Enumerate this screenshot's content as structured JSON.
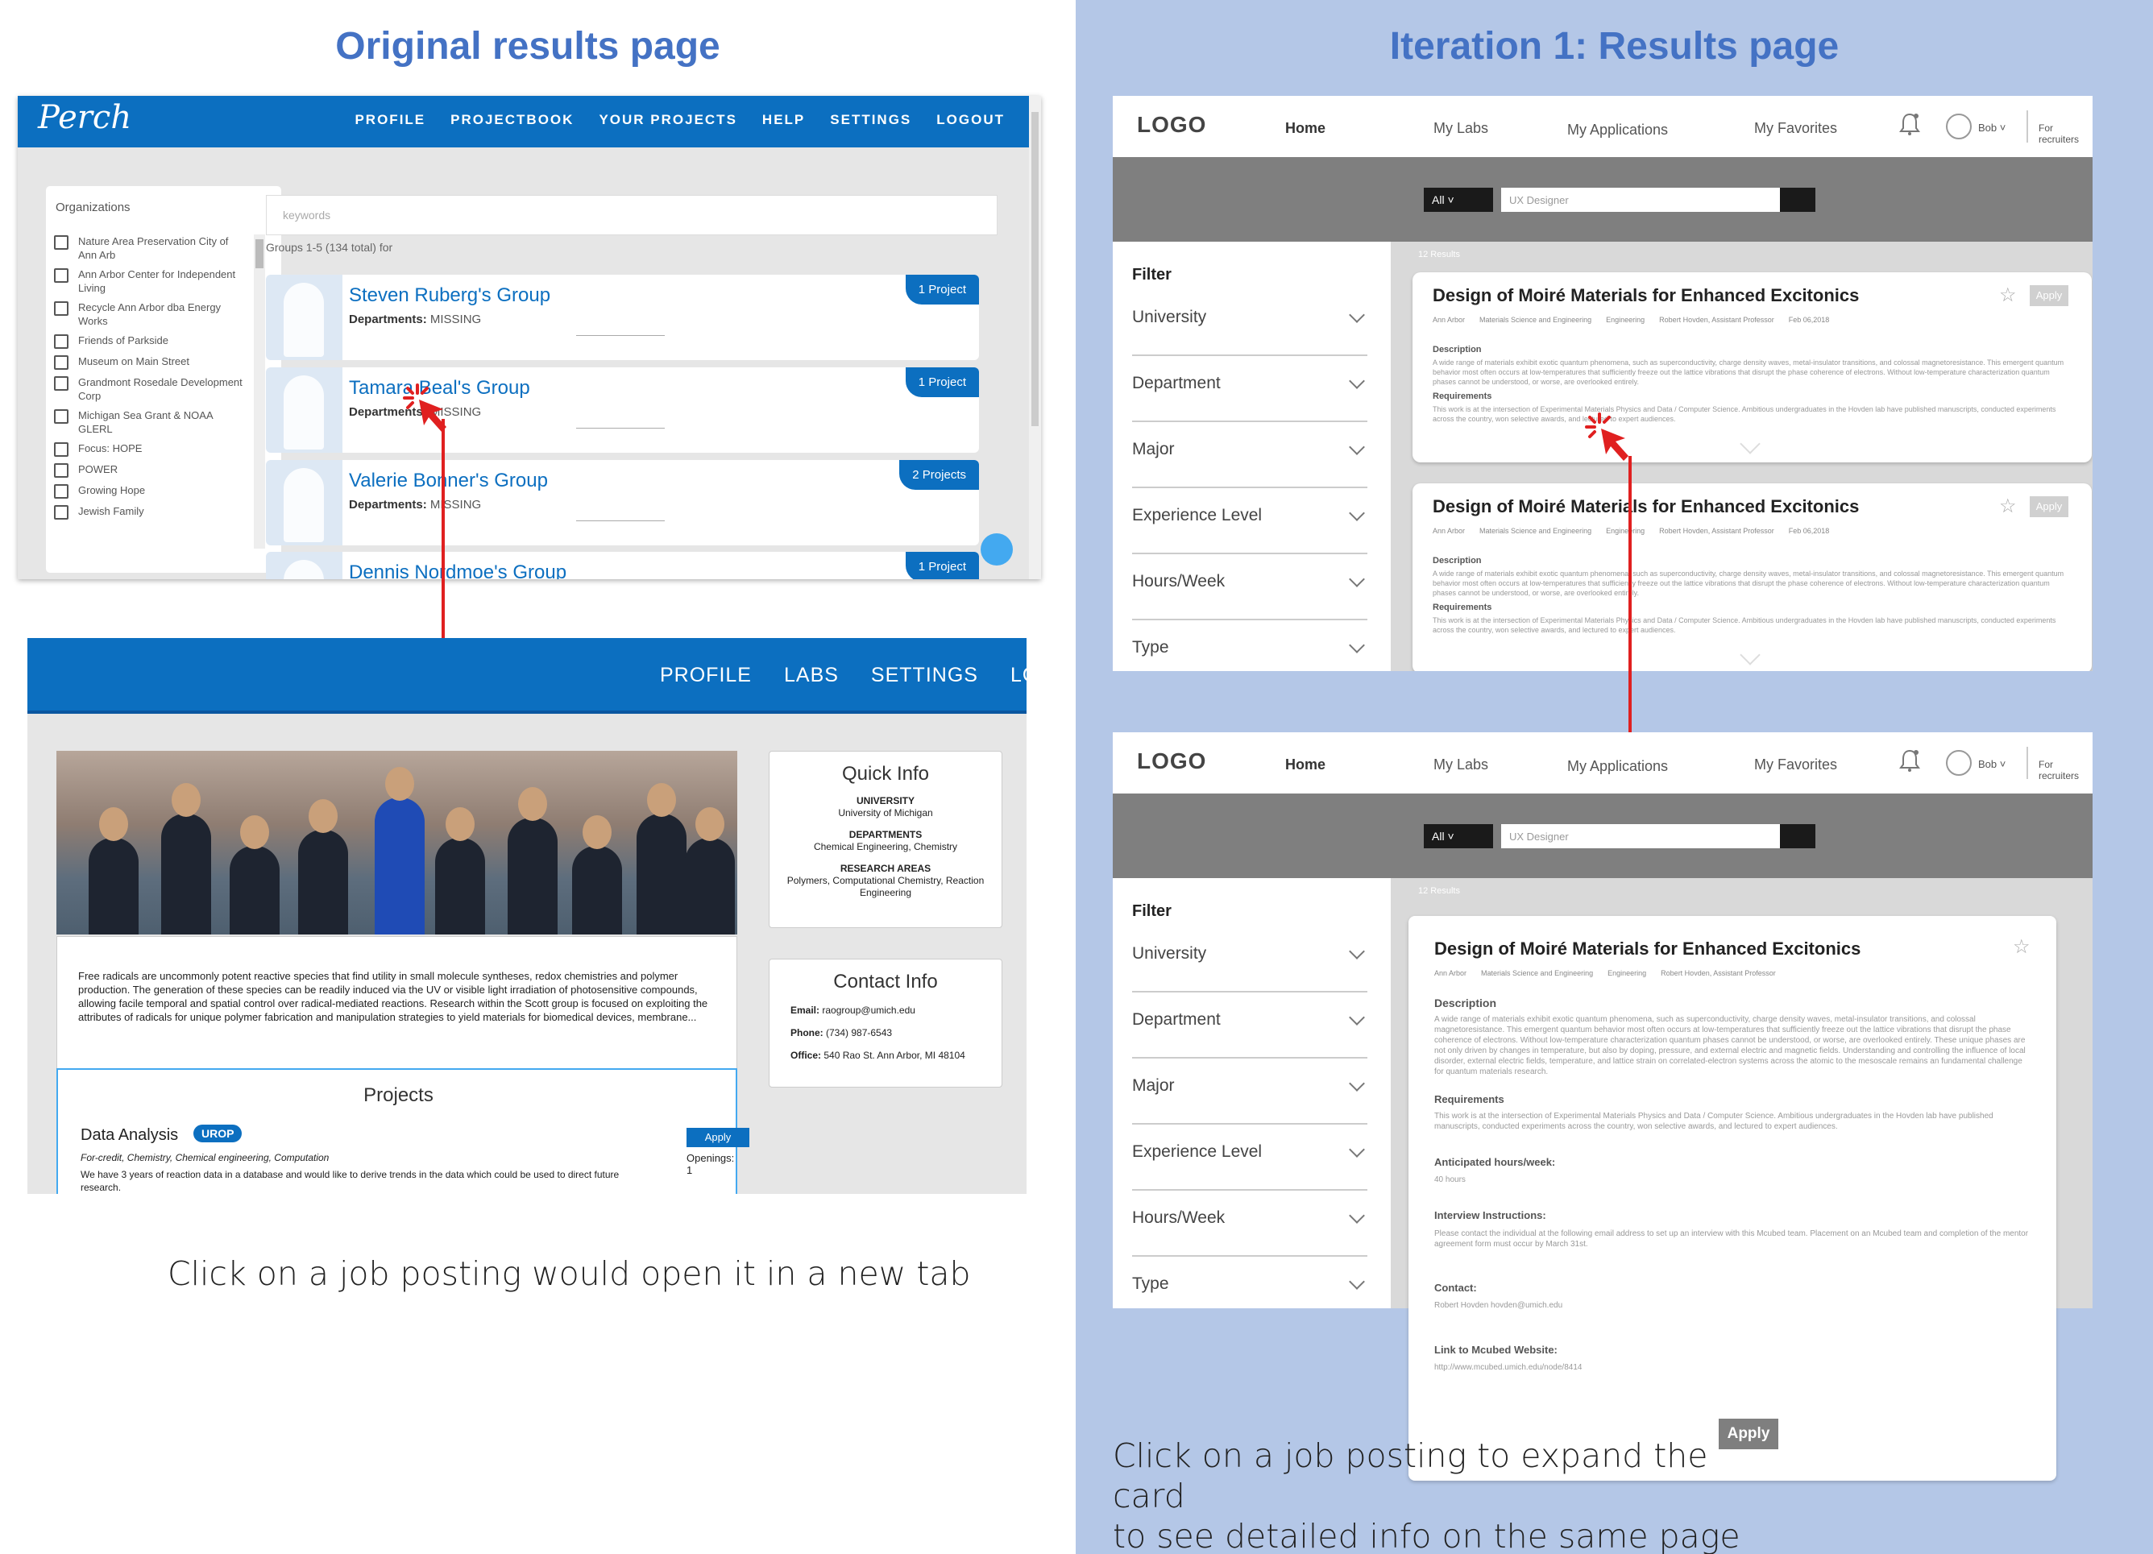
{
  "left": {
    "heading": "Original results page",
    "caption": "Click on a job posting would open it in a new tab",
    "perch": {
      "logo": "Perch",
      "nav": [
        "PROFILE",
        "PROJECTBOOK",
        "YOUR PROJECTS",
        "HELP",
        "SETTINGS",
        "LOGOUT"
      ],
      "organizations_title": "Organizations",
      "organizations": [
        "Nature Area Preservation City of Ann Arb",
        "Ann Arbor Center for Independent Living",
        "Recycle Ann Arbor dba Energy Works",
        "Friends of Parkside",
        "Museum on Main Street",
        "Grandmont Rosedale Development Corp",
        "Michigan Sea Grant & NOAA GLERL",
        "Focus: HOPE",
        "POWER",
        "Growing Hope",
        "Jewish Family"
      ],
      "keywords_placeholder": "keywords",
      "groups_info": "Groups 1-5 (134 total) for",
      "groups": [
        {
          "name": "Steven Ruberg's Group",
          "dept_label": "Departments:",
          "dept": "MISSING",
          "badge": "1 Project"
        },
        {
          "name": "Tamara Beal's Group",
          "dept_label": "Departments:",
          "dept": "MISSING",
          "badge": "1 Project"
        },
        {
          "name": "Valerie Bonner's Group",
          "dept_label": "Departments:",
          "dept": "MISSING",
          "badge": "2 Projects"
        },
        {
          "name": "Dennis Nordmoe's Group",
          "dept_label": "",
          "dept": "",
          "badge": "1 Project"
        }
      ]
    },
    "lab": {
      "nav": [
        "PROFILE",
        "LABS",
        "SETTINGS",
        "LO"
      ],
      "description": "Free radicals are uncommonly potent reactive species that find utility in small molecule syntheses, redox chemistries and polymer production. The generation of these species can be readily induced via the UV or visible light irradiation of photosensitive compounds, allowing facile temporal and spatial control over radical-mediated reactions. Research within the Scott group is focused on exploiting the attributes of radicals for unique polymer fabrication and manipulation strategies to yield materials for biomedical devices, membrane...",
      "quick_info": {
        "title": "Quick Info",
        "university_label": "UNIVERSITY",
        "university": "University of Michigan",
        "departments_label": "DEPARTMENTS",
        "departments": "Chemical Engineering, Chemistry",
        "research_label": "RESEARCH AREAS",
        "research": "Polymers, Computational Chemistry, Reaction Engineering"
      },
      "contact_info": {
        "title": "Contact Info",
        "email_label": "Email:",
        "email": "raogroup@umich.edu",
        "phone_label": "Phone:",
        "phone": "(734) 987-6543",
        "office_label": "Office:",
        "office": "540 Rao St. Ann Arbor, MI 48104"
      },
      "projects": {
        "title": "Projects",
        "name": "Data Analysis",
        "tag": "UROP",
        "fields": "For-credit, Chemistry, Chemical engineering, Computation",
        "desc": "We have 3 years of reaction data in a database and would like to derive trends in the data which could be used to direct future research.",
        "apply": "Apply",
        "openings": "Openings: 1"
      }
    }
  },
  "right": {
    "heading": "Iteration 1: Results page",
    "caption1": "Click on a job posting to expand the card",
    "caption2": "to see detailed info on the same page",
    "logo": "LOGO",
    "tabs": [
      "Home",
      "My Labs",
      "My Applications",
      "My Favorites"
    ],
    "user": "Bob",
    "recruiters": "For recruiters",
    "all": "All",
    "search_value": "UX Designer",
    "results": "12 Results",
    "filter": "Filter",
    "filters": [
      "University",
      "Department",
      "Major",
      "Experience Level",
      "Hours/Week",
      "Type"
    ],
    "job": {
      "title": "Design of Moiré Materials for Enhanced Excitonics",
      "location": "Ann Arbor",
      "dept": "Materials Science and Engineering",
      "field": "Engineering",
      "pi": "Robert Hovden, Assistant Professor",
      "date": "Feb 06,2018",
      "apply": "Apply",
      "desc_label": "Description",
      "desc": "A wide range of materials exhibit exotic quantum phenomena, such as superconductivity, charge density waves, metal-insulator transitions, and colossal magnetoresistance. This emergent quantum behavior most often occurs at low-temperatures that sufficiently freeze out the lattice vibrations that disrupt the phase coherence of electrons. Without low-temperature characterization quantum phases cannot be understood, or worse, are overlooked entirely.",
      "desc_extra": "These unique phases are not only driven by changes in temperature, but also by doping, pressure, and external electric and magnetic fields. Understanding and controlling the influence of local disorder, external electric fields, temperature, and lattice strain on correlated-electron systems across the atomic to the mesoscale remains an fundamental challenge for quantum materials research.",
      "req_label": "Requirements",
      "req": "This work is at the intersection of Experimental Materials Physics and Data / Computer Science. Ambitious undergraduates in the Hovden lab have published manuscripts, conducted experiments across the country, won selective awards, and lectured to expert audiences.",
      "hours_label": "Anticipated hours/week:",
      "hours": "40 hours",
      "interview_label": "Interview Instructions:",
      "interview": "Please contact the individual at the following email address to set up an interview with this Mcubed team. Placement on an Mcubed team and completion of the mentor agreement form must occur by March 31st.",
      "contact_label": "Contact:",
      "contact": "Robert Hovden hovden@umich.edu",
      "link_label": "Link to Mcubed Website:",
      "link": "http://www.mcubed.umich.edu/node/8414"
    }
  },
  "colors": {
    "accent": "#4472c4",
    "perch_blue": "#0c6fc0",
    "arrow": "#e02020",
    "right_bg": "#b4c7e7"
  }
}
